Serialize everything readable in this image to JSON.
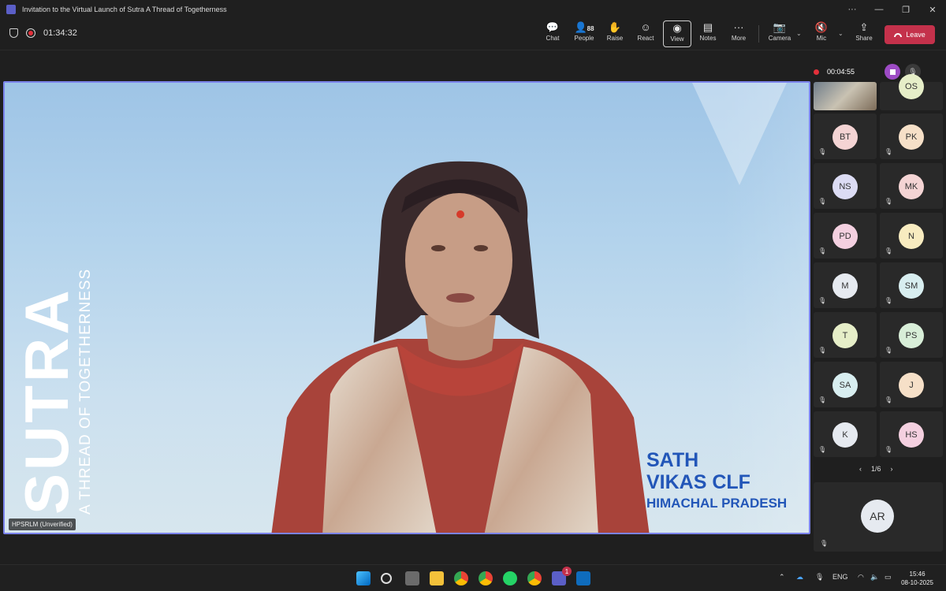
{
  "window": {
    "title": "Invitation to the Virtual Launch of Sutra   A Thread of Togetherness"
  },
  "toolbar": {
    "elapsed": "01:34:32",
    "buttons": [
      {
        "label": "Chat",
        "icon": "chat-icon"
      },
      {
        "label": "People",
        "count": "88",
        "icon": "people-icon"
      },
      {
        "label": "Raise",
        "icon": "hand-icon"
      },
      {
        "label": "React",
        "icon": "smiley-icon"
      },
      {
        "label": "View",
        "icon": "view-icon"
      },
      {
        "label": "Notes",
        "icon": "notes-icon"
      },
      {
        "label": "More",
        "icon": "more-icon"
      },
      {
        "label": "Camera",
        "icon": "camera-off-icon"
      },
      {
        "label": "Mic",
        "icon": "mic-off-icon"
      },
      {
        "label": "Share",
        "icon": "share-icon"
      }
    ],
    "leave_label": "Leave"
  },
  "stage": {
    "brand": "SUTRA",
    "tagline": "A THREAD OF TOGETHERNESS",
    "caption": [
      "SATH",
      "VIKAS CLF",
      "HIMACHAL PRADESH"
    ],
    "name_tag": "HPSRLM (Unverified)"
  },
  "recording": {
    "time": "00:04:55"
  },
  "participants": [
    {
      "initials": "",
      "photo": true
    },
    {
      "initials": "OS",
      "color": "#e6eec8"
    },
    {
      "initials": "BT",
      "color": "#f4d4d4"
    },
    {
      "initials": "PK",
      "color": "#f6e0c8"
    },
    {
      "initials": "NS",
      "color": "#dcdcf4"
    },
    {
      "initials": "MK",
      "color": "#f4d4d4"
    },
    {
      "initials": "PD",
      "color": "#f4d0e0"
    },
    {
      "initials": "N",
      "color": "#f8ecc0"
    },
    {
      "initials": "M",
      "color": "#e6eaf0"
    },
    {
      "initials": "SM",
      "color": "#d8eef0"
    },
    {
      "initials": "T",
      "color": "#e6eec8"
    },
    {
      "initials": "PS",
      "color": "#d8eed8"
    },
    {
      "initials": "SA",
      "color": "#d8eef0"
    },
    {
      "initials": "J",
      "color": "#f6e0c8"
    },
    {
      "initials": "K",
      "color": "#e6eaf0"
    },
    {
      "initials": "HS",
      "color": "#f4d0e0"
    }
  ],
  "pager": {
    "label": "1/6",
    "prev": "‹",
    "next": "›"
  },
  "featured": {
    "initials": "AR"
  },
  "taskbar": {
    "lang": "ENG",
    "time": "15:46",
    "date": "08-10-2025",
    "teams_badge": "1"
  }
}
